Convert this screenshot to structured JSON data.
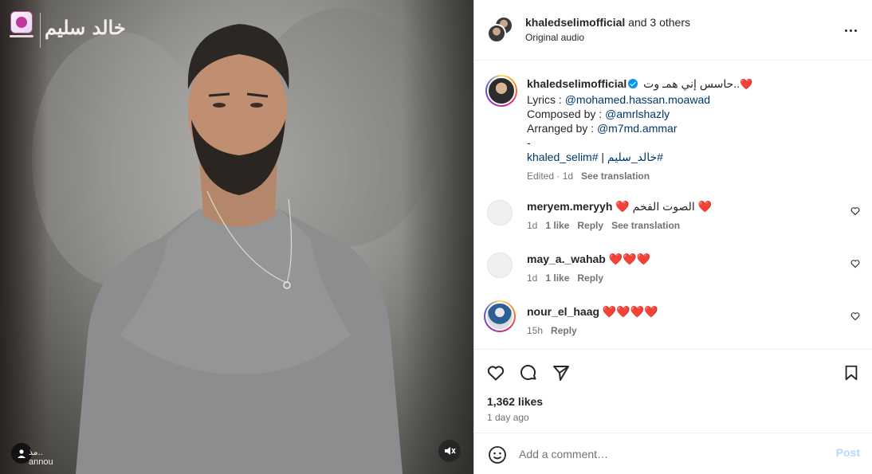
{
  "media": {
    "brand_name": "خالد سليم",
    "brand_logo_icon": "record-label-logo",
    "tagged_label": "مذ..\nannou",
    "tagged_user_icon": "user-icon",
    "mute_icon": "speaker-muted-icon"
  },
  "header": {
    "username": "khaledselimofficial",
    "collab_suffix": "and 3 others",
    "audio_label": "Original audio",
    "more_icon": "more-options-icon"
  },
  "caption": {
    "username": "khaledselimofficial",
    "verified_icon": "verified-badge-icon",
    "title_text": "حاسس إني همـ وت..",
    "title_emoji": "❤️",
    "lyrics_label": "Lyrics : ",
    "lyrics_handle": "@mohamed.hassan.moawad",
    "composed_label": "Composed by : ",
    "composed_handle": "@amrlshazly",
    "arranged_label": "Arranged by : ",
    "arranged_handle": "@m7md.ammar",
    "dash": "-",
    "hashtag_1": "khaled_selim#",
    "separator": " | ",
    "hashtag_2": "خالد_سليم#",
    "edited": "Edited · 1d",
    "see_translation": "See translation"
  },
  "comments": [
    {
      "username": "meryem.meryyh",
      "text": "❤️ الصوت الفخم ❤️",
      "time": "1d",
      "likes": "1 like",
      "reply": "Reply",
      "translation": "See translation"
    },
    {
      "username": "may_a._wahab",
      "text": "❤️❤️❤️",
      "time": "1d",
      "likes": "1 like",
      "reply": "Reply"
    },
    {
      "username": "nour_el_haag",
      "text": "❤️❤️❤️❤️",
      "time": "15h",
      "reply": "Reply"
    }
  ],
  "actions": {
    "like_icon": "heart-outline-icon",
    "comment_icon": "comment-bubble-icon",
    "share_icon": "paper-plane-icon",
    "save_icon": "bookmark-icon",
    "likes": "1,362 likes",
    "time_ago": "1 day ago"
  },
  "composer": {
    "emoji_icon": "smiley-icon",
    "placeholder": "Add a comment…",
    "post_label": "Post"
  },
  "colors": {
    "link": "#00376b",
    "muted": "#737373",
    "post_disabled": "#b3dbff",
    "verified": "#0095f6",
    "heart": "#e0245e"
  }
}
